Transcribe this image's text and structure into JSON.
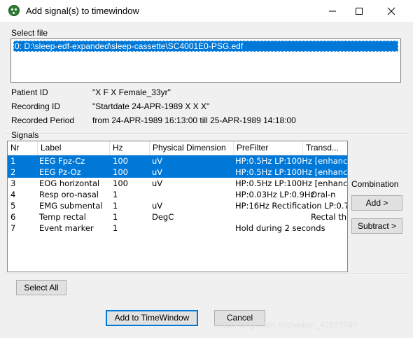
{
  "window": {
    "title": "Add signal(s) to timewindow"
  },
  "file": {
    "label": "Select file",
    "items": [
      "0: D:\\sleep-edf-expanded\\sleep-cassette\\SC4001E0-PSG.edf"
    ]
  },
  "info": {
    "patient_label": "Patient ID",
    "patient_value": "\"X F X Female_33yr\"",
    "recording_label": "Recording ID",
    "recording_value": "\"Startdate 24-APR-1989 X X X\"",
    "period_label": "Recorded Period",
    "period_value": "from 24-APR-1989 16:13:00 till 25-APR-1989 14:18:00"
  },
  "signals": {
    "label": "Signals",
    "columns": [
      "Nr",
      "Label",
      "Hz",
      "Physical Dimension",
      "PreFilter",
      "Transd..."
    ],
    "rows": [
      {
        "nr": "1",
        "label": "EEG Fpz-Cz",
        "hz": "100",
        "dim": "uV",
        "prefilter": "HP:0.5Hz LP:100Hz [enhanc",
        "transducer": "",
        "selected": true
      },
      {
        "nr": "2",
        "label": "EEG Pz-Oz",
        "hz": "100",
        "dim": "uV",
        "prefilter": "HP:0.5Hz LP:100Hz [enhanc",
        "transducer": "",
        "selected": true
      },
      {
        "nr": "3",
        "label": "EOG horizontal",
        "hz": "100",
        "dim": "uV",
        "prefilter": "HP:0.5Hz LP:100Hz [enhanc",
        "transducer": "",
        "selected": false
      },
      {
        "nr": "4",
        "label": "Resp oro-nasal",
        "hz": "1",
        "dim": "",
        "prefilter": "HP:0.03Hz LP:0.9Hz",
        "transducer": "Oral-n",
        "selected": false
      },
      {
        "nr": "5",
        "label": "EMG submental",
        "hz": "1",
        "dim": "uV",
        "prefilter": "HP:16Hz Rectification LP:0.7",
        "transducer": "",
        "selected": false
      },
      {
        "nr": "6",
        "label": "Temp rectal",
        "hz": "1",
        "dim": "DegC",
        "prefilter": "",
        "transducer": "Rectal the",
        "selected": false
      },
      {
        "nr": "7",
        "label": "Event marker",
        "hz": "1",
        "dim": "",
        "prefilter": "Hold during 2 seconds",
        "transducer": "",
        "selected": false
      }
    ]
  },
  "combination": {
    "label": "Combination",
    "add_label": "Add >",
    "subtract_label": "Subtract >"
  },
  "buttons": {
    "select_all": "Select All",
    "add_to_timewindow": "Add to TimeWindow",
    "cancel": "Cancel"
  },
  "watermark": "https://blog.csdn.net/weixin_42920780"
}
